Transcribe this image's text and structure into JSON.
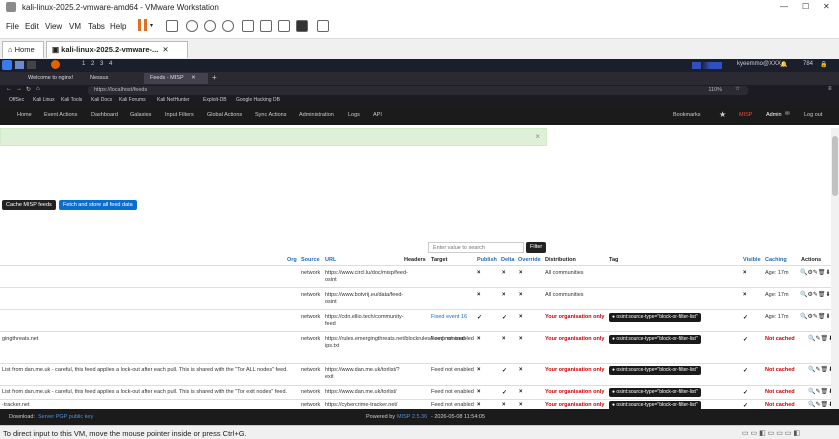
{
  "vmware": {
    "window_title": "kali-linux-2025.2-vmware-amd64 - VMware Workstation",
    "menu": [
      "File",
      "Edit",
      "View",
      "VM",
      "Tabs",
      "Help"
    ],
    "tabs": [
      {
        "label": "Home"
      },
      {
        "label": "kali-linux-2025.2-vmware-..."
      }
    ],
    "status_text": "To direct input to this VM, move the mouse pointer inside or press Ctrl+G."
  },
  "kali_panel": {
    "workspaces": [
      "1",
      "2",
      "3",
      "4"
    ],
    "user": "kyeemmo@XXX",
    "battery": "784"
  },
  "browser": {
    "tabs": [
      {
        "label": "Welcome to nginx!"
      },
      {
        "label": "Nessus"
      },
      {
        "label": "Feeds - MISP"
      }
    ],
    "url": "https://localhost/feeds",
    "zoom": "110%",
    "bookmarks": [
      "OffSec",
      "Kali Linux",
      "Kali Tools",
      "Kali Docs",
      "Kali Forums",
      "Kali NetHunter",
      "Exploit-DB",
      "Google Hacking DB"
    ]
  },
  "misp": {
    "nav_left": [
      "Home",
      "Event Actions",
      "Dashboard",
      "Galaxies",
      "Input Filters",
      "Global Actions",
      "Sync Actions",
      "Administration",
      "Logs",
      "API"
    ],
    "nav_right": {
      "bookmarks": "Bookmarks",
      "brand": "MISP",
      "user": "Admin",
      "logout": "Log out"
    },
    "buttons": {
      "cache": "Cache MISP feeds",
      "fetch": "Fetch and store all feed data",
      "filter": "Filter"
    },
    "filter_placeholder": "Enter value to search",
    "columns": [
      "Org",
      "Source",
      "URL",
      "Headers",
      "Target",
      "Publish",
      "Delta",
      "Override",
      "Distribution",
      "Tag",
      "Visible",
      "Caching",
      "Actions"
    ],
    "rows": [
      {
        "name": "",
        "source": "network",
        "url": "https://www.circl.lu/doc/misp/feed-osint",
        "target": "",
        "publish": "×",
        "delta": "×",
        "override": "×",
        "distribution": "All communities",
        "tag": "",
        "visible": "×",
        "caching": "Age: 17m"
      },
      {
        "name": "",
        "source": "network",
        "url": "https://www.botvrij.eu/data/feed-osint",
        "target": "",
        "publish": "×",
        "delta": "×",
        "override": "×",
        "distribution": "All communities",
        "tag": "",
        "visible": "×",
        "caching": "Age: 17m"
      },
      {
        "name": "",
        "source": "network",
        "url": "https://cdn.ellio.tech/community-feed",
        "target": "Fixed event 16",
        "publish": "✓",
        "delta": "✓",
        "override": "×",
        "distribution": "Your organisation only",
        "tag": "osint:source-type=\"block-or-filter-list\"",
        "visible": "✓",
        "caching": "Age: 17m"
      },
      {
        "name": "gingthreats.net",
        "source": "network",
        "url": "https://rules.emergingthreats.net/blockrules/compromised-ips.txt",
        "target": "Feed not enabled",
        "publish": "×",
        "delta": "×",
        "override": "×",
        "distribution": "Your organisation only",
        "tag": "osint:source-type=\"block-or-filter-list\"",
        "visible": "✓",
        "caching": "Not cached"
      },
      {
        "name": "List from dan.me.uk - careful, this feed applies a lock-out after each pull. This is shared with the \"Tor ALL nodes\" feed.",
        "source": "network",
        "url": "https://www.dan.me.uk/torlist/?exit",
        "target": "Feed not enabled",
        "publish": "×",
        "delta": "✓",
        "override": "×",
        "distribution": "Your organisation only",
        "tag": "osint:source-type=\"block-or-filter-list\"",
        "visible": "✓",
        "caching": "Not cached"
      },
      {
        "name": "List from dan.me.uk - careful, this feed applies a lock-out after each pull. This is shared with the \"Tor exit nodes\" feed.",
        "source": "network",
        "url": "https://www.dan.me.uk/torlist/",
        "target": "Feed not enabled",
        "publish": "×",
        "delta": "✓",
        "override": "×",
        "distribution": "Your organisation only",
        "tag": "osint:source-type=\"block-or-filter-list\"",
        "visible": "✓",
        "caching": "Not cached"
      },
      {
        "name": "-tracker.net",
        "source": "network",
        "url": "https://cybercrime-tracker.net/",
        "target": "Feed not enabled",
        "publish": "×",
        "delta": "×",
        "override": "×",
        "distribution": "Your organisation only",
        "tag": "osint:source-type=\"block-or-filter-list\"",
        "visible": "✓",
        "caching": "Not cached"
      }
    ],
    "footer": {
      "download_label": "Download:",
      "download_link": "Server PGP public key",
      "powered": "Powered by",
      "version": "MISP 2.5.36",
      "date": "- 2026-05-08 11:54:05"
    }
  }
}
